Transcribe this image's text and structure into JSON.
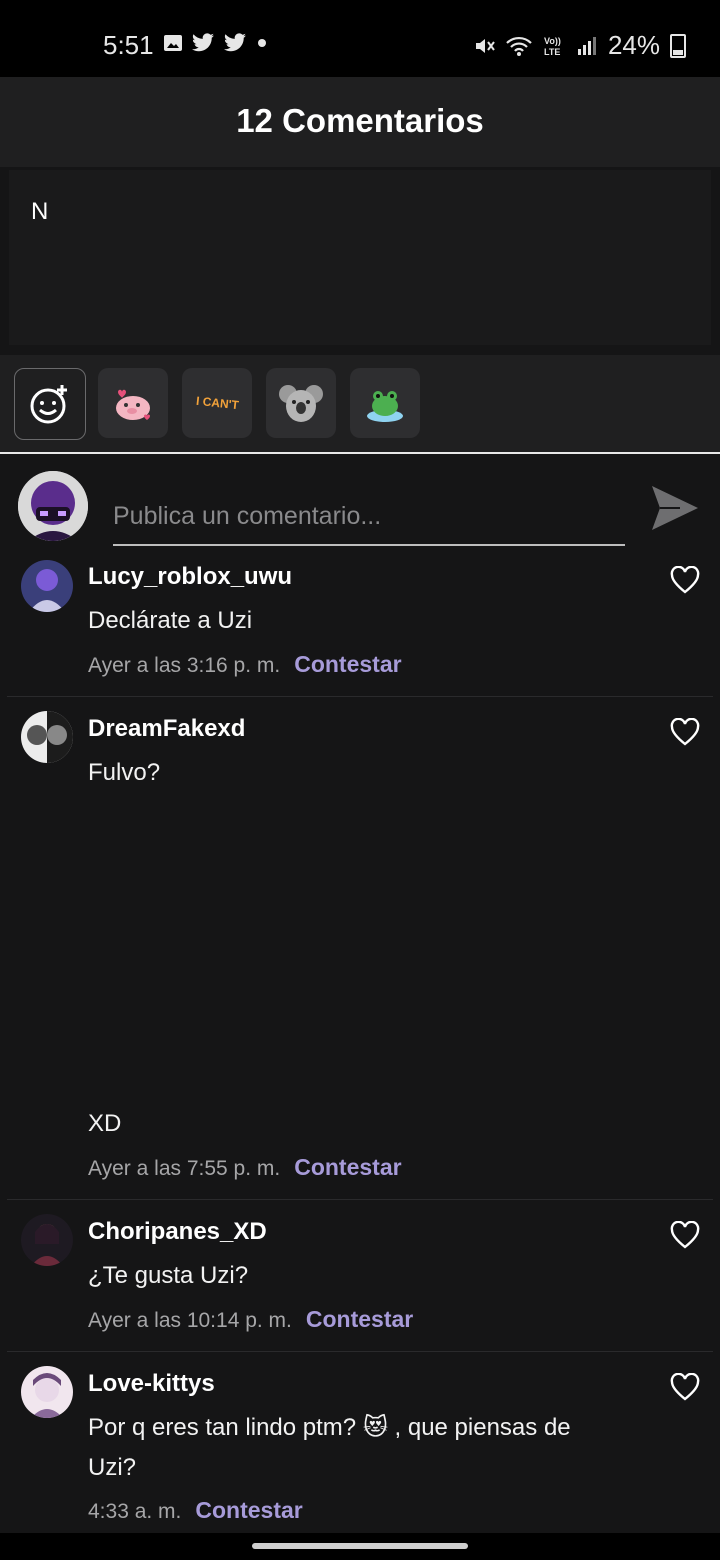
{
  "status_bar": {
    "time": "5:51",
    "battery": "24%",
    "left_icons": [
      "image-icon",
      "twitter-icon",
      "twitter-icon",
      "dot-icon"
    ],
    "right_icons": [
      "mute-icon",
      "wifi-icon",
      "volte-icon",
      "signal-icon",
      "battery-icon"
    ]
  },
  "header": {
    "title": "12 Comentarios"
  },
  "comment_box": {
    "text": "N"
  },
  "stickers": [
    "emoji-add-icon",
    "pig-sticker",
    "i-cant-sticker",
    "koala-sticker",
    "frog-sticker"
  ],
  "sticker_texts": {
    "i_cant": "I CAN'T"
  },
  "publish": {
    "placeholder": "Publica un comentario..."
  },
  "comments": [
    {
      "user": "Lucy_roblox_uwu",
      "text": "Declárate a Uzi",
      "time": "Ayer a las 3:16 p. m.",
      "reply": "Contestar"
    },
    {
      "user": "DreamFakexd",
      "text": "Fulvo?",
      "text_2": "XD",
      "time": "Ayer a las 7:55 p. m.",
      "reply": "Contestar"
    },
    {
      "user": "Choripanes_XD",
      "text": "¿Te gusta Uzi?",
      "time": "Ayer a las 10:14 p. m.",
      "reply": "Contestar"
    },
    {
      "user": "Love-kittys",
      "text": "Por q eres tan lindo ptm? 😻 , que piensas de Uzi?",
      "time": "4:33 a. m.",
      "reply": "Contestar"
    }
  ],
  "colors": {
    "background": "#151516",
    "header": "#1f1f20",
    "reply_accent": "#a79bd9"
  }
}
